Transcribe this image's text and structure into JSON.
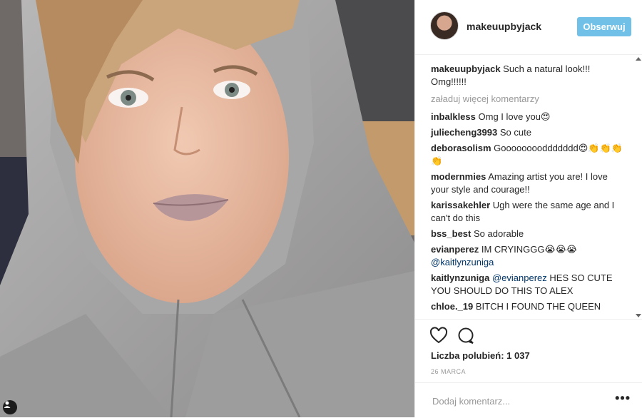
{
  "post": {
    "username": "makeuupbyjack",
    "follow_label": "Obserwuj",
    "caption": {
      "user": "makeuupbyjack",
      "text": "Such a natural look!!! Omg!!!!!!"
    },
    "load_more": "załaduj więcej komentarzy",
    "comments": [
      {
        "user": "inbalkless",
        "text": "Omg I love you😍"
      },
      {
        "user": "juliecheng3993",
        "text": "So cute"
      },
      {
        "user": "deborasolism",
        "text": "Gooooooooddddddd😍👏👏👏👏"
      },
      {
        "user": "modernmies",
        "text": "Amazing artist you are! I love your style and courage!!"
      },
      {
        "user": "karissakehler",
        "text": "Ugh were the same age and I can't do this"
      },
      {
        "user": "bss_best",
        "text": "So adorable"
      },
      {
        "user": "evianperez",
        "text": "IM CRYINGGG😭😭😭",
        "mention": "@kaitlynzuniga"
      },
      {
        "user": "kaitlynzuniga",
        "mention": "@evianperez",
        "text": "HES SO CUTE YOU SHOULD DO THIS TO ALEX"
      },
      {
        "user": "chloe._19",
        "text": "BITCH I FOUND THE QUEEN"
      }
    ],
    "likes": "Liczba polubień: 1 037",
    "date": "26 MARCA",
    "add_comment_placeholder": "Dodaj komentarz...",
    "more_label": "•••"
  },
  "icons": {
    "like": "heart-icon",
    "comment": "speech-bubble-icon",
    "user_tag": "person-icon"
  },
  "colors": {
    "follow_button": "#70c0e7",
    "mention": "#003569",
    "muted": "#999999"
  }
}
